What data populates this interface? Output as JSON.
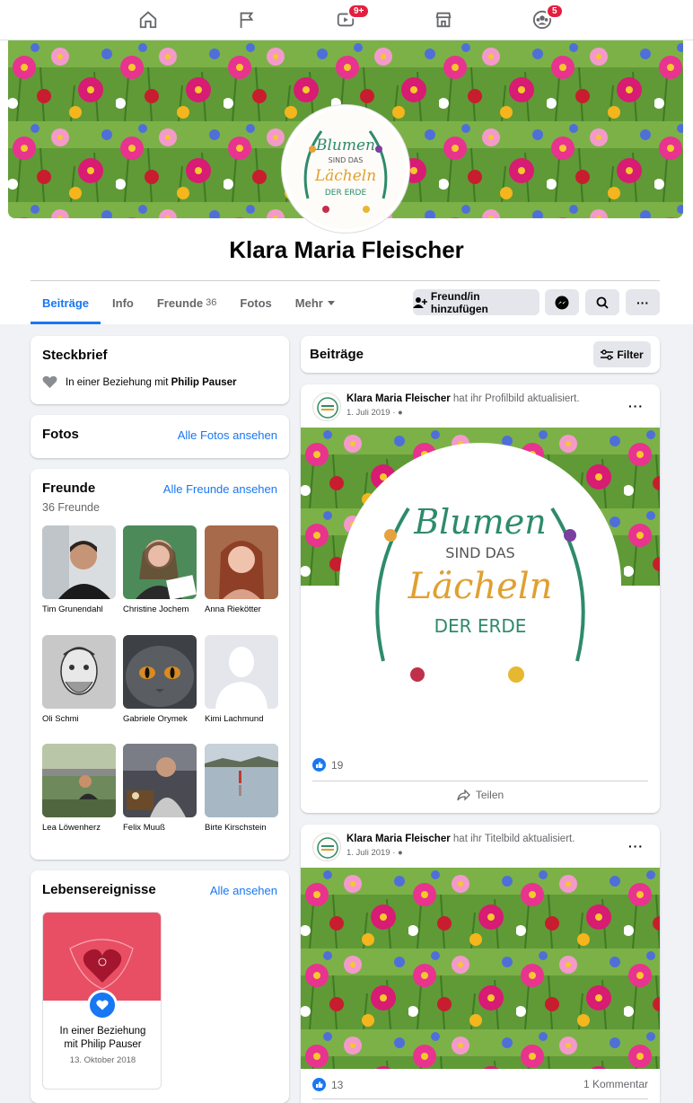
{
  "nav": {
    "watch_badge": "9+",
    "groups_badge": "5"
  },
  "profile": {
    "name": "Klara Maria Fleischer",
    "logo_text": [
      "Blumen",
      "SIND DAS",
      "Lächeln",
      "DER ERDE"
    ]
  },
  "tabs": [
    {
      "label": "Beiträge"
    },
    {
      "label": "Info"
    },
    {
      "label": "Freunde",
      "count": "36"
    },
    {
      "label": "Fotos"
    },
    {
      "label": "Mehr"
    }
  ],
  "actions": {
    "add_friend": "Freund/in hinzufügen"
  },
  "steckbrief": {
    "title": "Steckbrief",
    "relationship_prefix": "In einer Beziehung mit",
    "partner": "Philip Pauser"
  },
  "fotos": {
    "title": "Fotos",
    "link": "Alle Fotos ansehen"
  },
  "freunde": {
    "title": "Freunde",
    "count_label": "36 Freunde",
    "link": "Alle Freunde ansehen",
    "items": [
      {
        "name": "Tim Grunendahl"
      },
      {
        "name": "Christine Jochem"
      },
      {
        "name": "Anna Riekötter"
      },
      {
        "name": "Oli Schmi"
      },
      {
        "name": "Gabriele Orymek"
      },
      {
        "name": "Kimi Lachmund"
      },
      {
        "name": "Lea Löwenherz"
      },
      {
        "name": "Felix Muuß"
      },
      {
        "name": "Birte Kirschstein"
      }
    ]
  },
  "events": {
    "title": "Lebensereignisse",
    "link": "Alle ansehen",
    "item_line1": "In einer Beziehung",
    "item_line2": "mit Philip Pauser",
    "item_date": "13. Oktober 2018"
  },
  "posts_header": {
    "title": "Beiträge",
    "filter": "Filter"
  },
  "posts": [
    {
      "author": "Klara Maria Fleischer",
      "action": "hat ihr Profilbild aktualisiert.",
      "date": "1. Juli 2019 ·",
      "likes": "19",
      "share": "Teilen"
    },
    {
      "author": "Klara Maria Fleischer",
      "action": "hat ihr Titelbild aktualisiert.",
      "date": "1. Juli 2019 ·",
      "likes": "13",
      "comments": "1 Kommentar"
    }
  ],
  "colors": {
    "accent": "#1877f2",
    "badge": "#e41e3f",
    "background": "#f0f2f5"
  }
}
